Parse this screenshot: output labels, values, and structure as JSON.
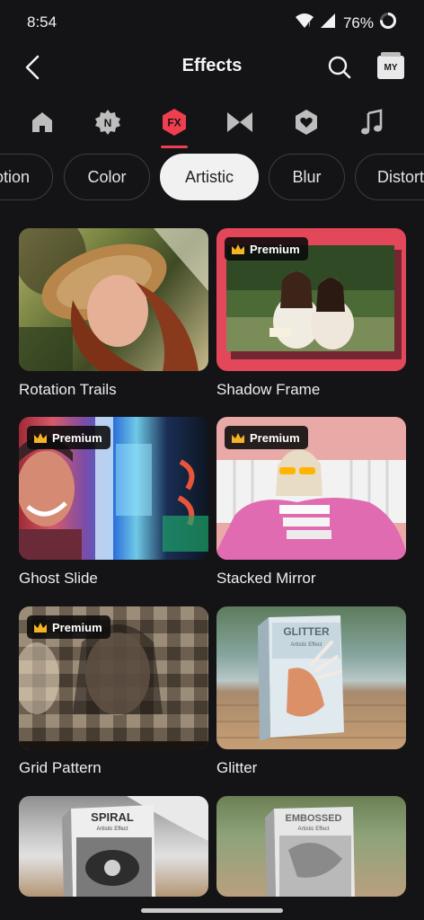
{
  "status_bar": {
    "time": "8:54",
    "battery": "76%"
  },
  "header": {
    "title": "Effects",
    "my_label": "MY"
  },
  "category_tabs": [
    {
      "name": "home",
      "icon": "home-icon"
    },
    {
      "name": "new",
      "icon": "new-badge-icon",
      "glyph": "N"
    },
    {
      "name": "fx",
      "icon": "fx-icon",
      "glyph": "FX",
      "active": true
    },
    {
      "name": "transition",
      "icon": "bowtie-icon"
    },
    {
      "name": "favorite",
      "icon": "heart-icon"
    },
    {
      "name": "music",
      "icon": "music-note-icon"
    }
  ],
  "filter_chips": [
    {
      "label": "Motion"
    },
    {
      "label": "Color"
    },
    {
      "label": "Artistic",
      "active": true
    },
    {
      "label": "Blur"
    },
    {
      "label": "Distortion"
    }
  ],
  "premium_label": "Premium",
  "effects": [
    {
      "label": "Rotation Trails",
      "premium": false
    },
    {
      "label": "Shadow Frame",
      "premium": true
    },
    {
      "label": "Ghost Slide",
      "premium": true
    },
    {
      "label": "Stacked Mirror",
      "premium": true
    },
    {
      "label": "Grid Pattern",
      "premium": true
    },
    {
      "label": "Glitter",
      "premium": false,
      "box_title": "GLITTER",
      "box_sub": "Artistic Effect"
    },
    {
      "label": "",
      "premium": false,
      "box_title": "SPIRAL",
      "box_sub": "Artistic Effect"
    },
    {
      "label": "",
      "premium": false,
      "box_title": "EMBOSSED",
      "box_sub": "Artistic Effect"
    }
  ],
  "colors": {
    "accent": "#ee3e4f",
    "background": "#141416",
    "premium_gold": "#f5b325"
  }
}
